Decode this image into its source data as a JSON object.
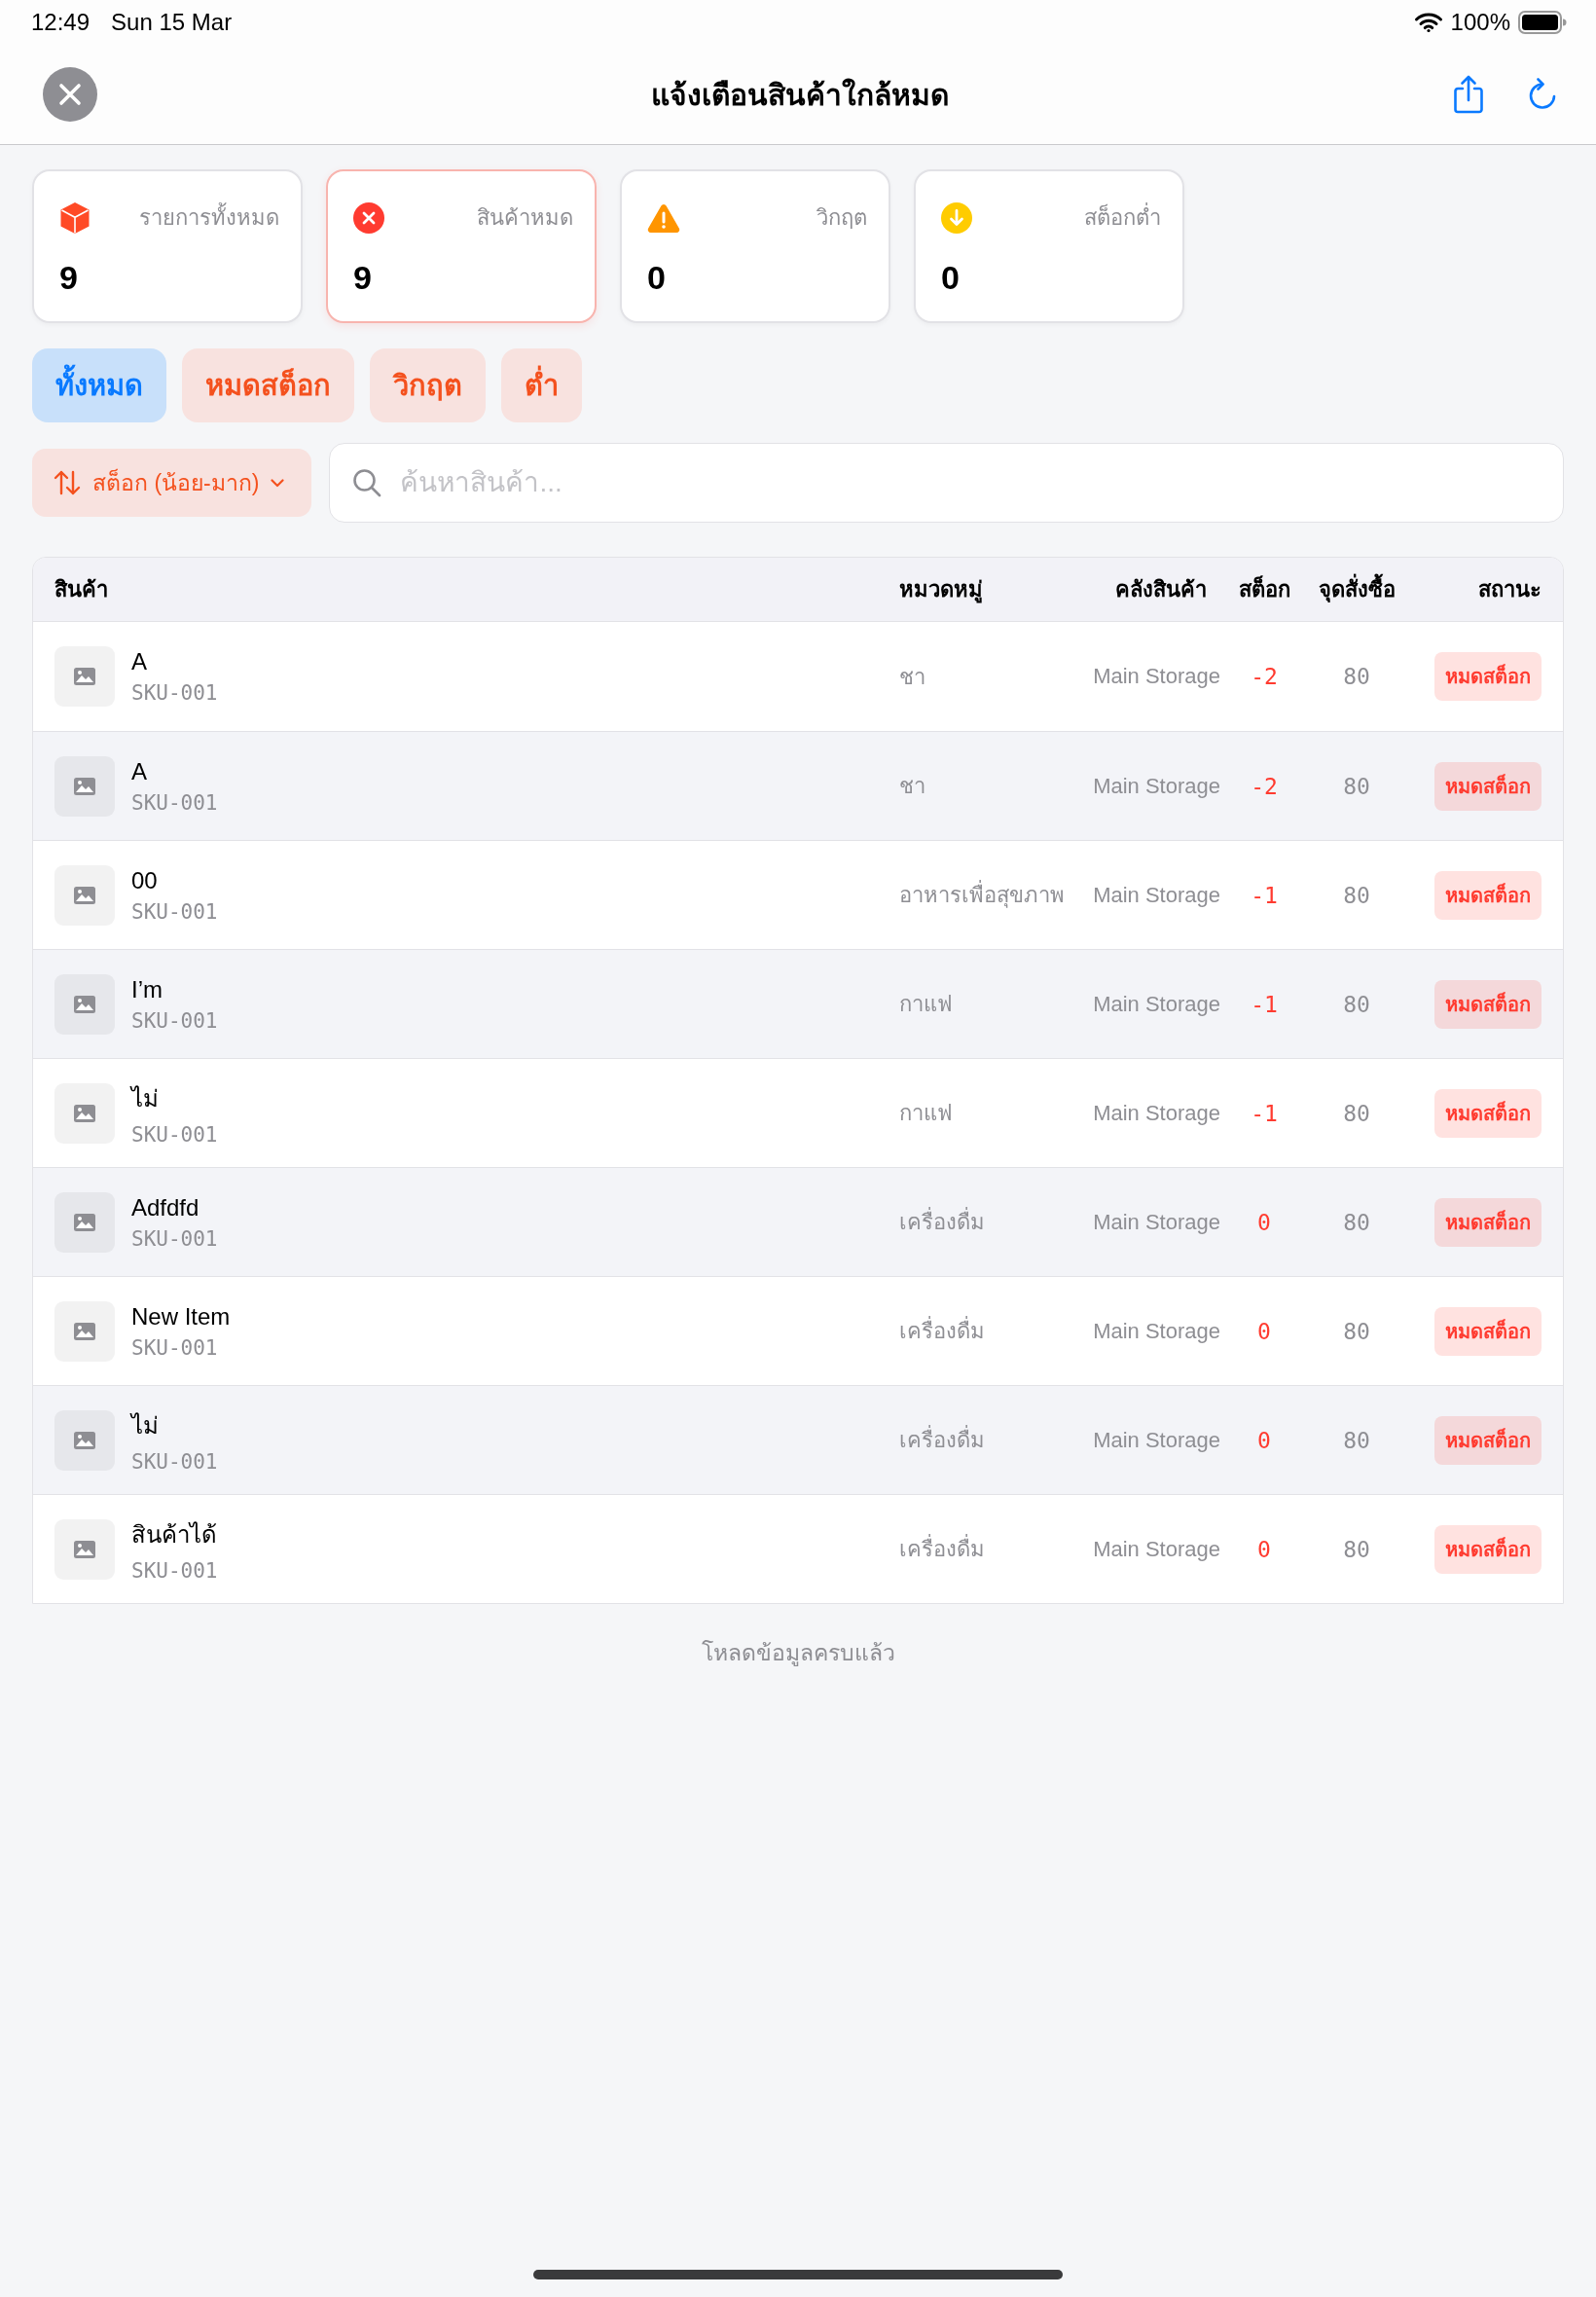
{
  "status_bar": {
    "time": "12:49",
    "date": "Sun 15 Mar",
    "battery": "100%"
  },
  "nav": {
    "title": "แจ้งเตือนสินค้าใกล้หมด"
  },
  "stat_cards": [
    {
      "kind": "total",
      "label": "รายการทั้งหมด",
      "value": "9",
      "highlighted": false
    },
    {
      "kind": "out",
      "label": "สินค้าหมด",
      "value": "9",
      "highlighted": true
    },
    {
      "kind": "critical",
      "label": "วิกฤต",
      "value": "0",
      "highlighted": false
    },
    {
      "kind": "low",
      "label": "สต็อกต่ำ",
      "value": "0",
      "highlighted": false
    }
  ],
  "filter_chips": [
    {
      "label": "ทั้งหมด",
      "selected": true
    },
    {
      "label": "หมดสต็อก",
      "selected": false
    },
    {
      "label": "วิกฤต",
      "selected": false
    },
    {
      "label": "ต่ำ",
      "selected": false
    }
  ],
  "sort_button": {
    "label": "สต็อก (น้อย-มาก)"
  },
  "search": {
    "placeholder": "ค้นหาสินค้า..."
  },
  "table": {
    "columns": [
      "สินค้า",
      "หมวดหมู่",
      "คลังสินค้า",
      "สต็อก",
      "จุดสั่งซื้อ",
      "สถานะ"
    ],
    "rows": [
      {
        "name": "A",
        "sku": "SKU-001",
        "category": "ชา",
        "storage": "Main Storage",
        "stock": "-2",
        "reorder_point": "80",
        "status": "หมดสต็อก"
      },
      {
        "name": "A",
        "sku": "SKU-001",
        "category": "ชา",
        "storage": "Main Storage",
        "stock": "-2",
        "reorder_point": "80",
        "status": "หมดสต็อก"
      },
      {
        "name": "00",
        "sku": "SKU-001",
        "category": "อาหารเพื่อสุขภาพ",
        "storage": "Main Storage",
        "stock": "-1",
        "reorder_point": "80",
        "status": "หมดสต็อก"
      },
      {
        "name": "I’m",
        "sku": "SKU-001",
        "category": "กาแฟ",
        "storage": "Main Storage",
        "stock": "-1",
        "reorder_point": "80",
        "status": "หมดสต็อก"
      },
      {
        "name": "ไม่",
        "sku": "SKU-001",
        "category": "กาแฟ",
        "storage": "Main Storage",
        "stock": "-1",
        "reorder_point": "80",
        "status": "หมดสต็อก"
      },
      {
        "name": "Adfdfd",
        "sku": "SKU-001",
        "category": "เครื่องดื่ม",
        "storage": "Main Storage",
        "stock": "0",
        "reorder_point": "80",
        "status": "หมดสต็อก"
      },
      {
        "name": "New Item",
        "sku": "SKU-001",
        "category": "เครื่องดื่ม",
        "storage": "Main Storage",
        "stock": "0",
        "reorder_point": "80",
        "status": "หมดสต็อก"
      },
      {
        "name": "ไม่",
        "sku": "SKU-001",
        "category": "เครื่องดื่ม",
        "storage": "Main Storage",
        "stock": "0",
        "reorder_point": "80",
        "status": "หมดสต็อก"
      },
      {
        "name": "สินค้าได้",
        "sku": "SKU-001",
        "category": "เครื่องดื่ม",
        "storage": "Main Storage",
        "stock": "0",
        "reorder_point": "80",
        "status": "หมดสต็อก"
      }
    ]
  },
  "footer": {
    "text": "โหลดข้อมูลครบแล้ว"
  }
}
